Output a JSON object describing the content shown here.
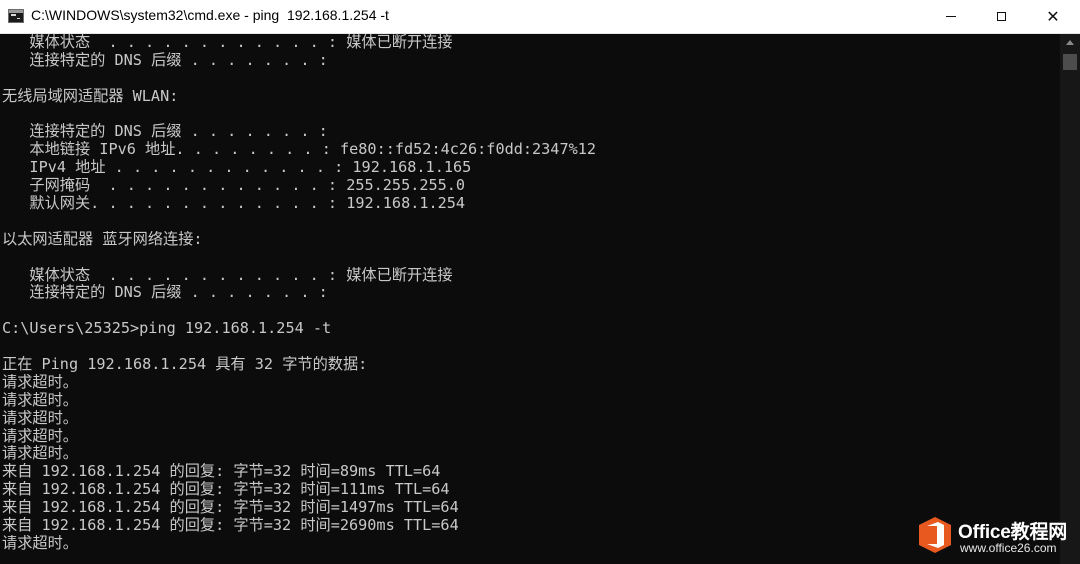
{
  "window": {
    "title": "C:\\WINDOWS\\system32\\cmd.exe - ping  192.168.1.254 -t",
    "buttons": {
      "minimize": "minimize",
      "maximize": "maximize",
      "close": "✕"
    }
  },
  "console": {
    "lines": [
      "   媒体状态  . . . . . . . . . . . . : 媒体已断开连接",
      "   连接特定的 DNS 后缀 . . . . . . . :",
      "",
      "无线局域网适配器 WLAN:",
      "",
      "   连接特定的 DNS 后缀 . . . . . . . :",
      "   本地链接 IPv6 地址. . . . . . . . : fe80::fd52:4c26:f0dd:2347%12",
      "   IPv4 地址 . . . . . . . . . . . . : 192.168.1.165",
      "   子网掩码  . . . . . . . . . . . . : 255.255.255.0",
      "   默认网关. . . . . . . . . . . . . : 192.168.1.254",
      "",
      "以太网适配器 蓝牙网络连接:",
      "",
      "   媒体状态  . . . . . . . . . . . . : 媒体已断开连接",
      "   连接特定的 DNS 后缀 . . . . . . . :",
      "",
      "C:\\Users\\25325>ping 192.168.1.254 -t",
      "",
      "正在 Ping 192.168.1.254 具有 32 字节的数据:",
      "请求超时。",
      "请求超时。",
      "请求超时。",
      "请求超时。",
      "请求超时。",
      "来自 192.168.1.254 的回复: 字节=32 时间=89ms TTL=64",
      "来自 192.168.1.254 的回复: 字节=32 时间=111ms TTL=64",
      "来自 192.168.1.254 的回复: 字节=32 时间=1497ms TTL=64",
      "来自 192.168.1.254 的回复: 字节=32 时间=2690ms TTL=64",
      "请求超时。"
    ]
  },
  "watermark": {
    "brand": "Office教程网",
    "url": "www.office26.com",
    "logo_icon": "office-logo-icon"
  },
  "colors": {
    "console_bg": "#0c0c0c",
    "console_fg": "#c8c8c8",
    "titlebar_bg": "#ffffff",
    "watermark_orange": "#e8591f"
  }
}
